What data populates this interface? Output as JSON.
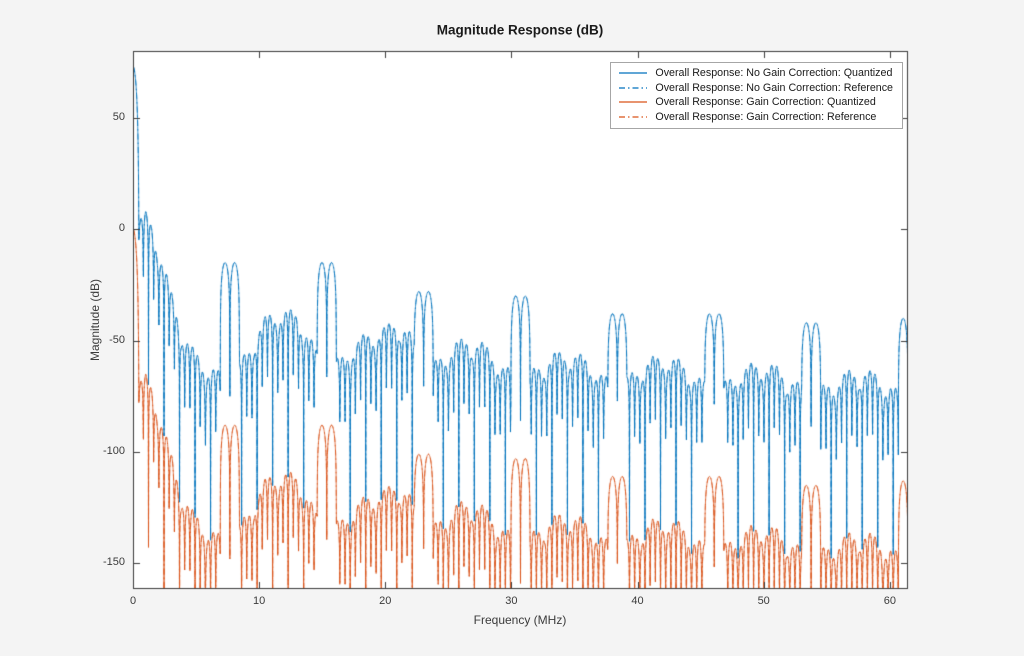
{
  "window": {
    "background": "#f4f4f4",
    "axes_background": "#ffffff"
  },
  "colors": {
    "axis_line": "#3b3b3b",
    "tick_label": "#3b3b3b",
    "title_text": "#1a1a1a",
    "legend_border": "#a6a6a6",
    "matlab_blue": "#0072BD",
    "matlab_orange": "#D95319"
  },
  "chart_data": {
    "type": "line",
    "title": "Magnitude Response (dB)",
    "xlabel": "Frequency (MHz)",
    "ylabel": "Magnitude (dB)",
    "xlim": [
      0,
      61.44
    ],
    "ylim": [
      -161.5,
      80
    ],
    "x_ticks": [
      0,
      10,
      20,
      30,
      40,
      50,
      60
    ],
    "y_ticks": [
      -150,
      -100,
      -50,
      0,
      50
    ],
    "grid": false,
    "legend_position": "northeast",
    "series": [
      {
        "name": "Overall Response: No Gain Correction: Quantized",
        "color": "#0072BD",
        "style": "solid",
        "gain_offset_db": 0
      },
      {
        "name": "Overall Response: No Gain Correction: Reference",
        "color": "#0072BD",
        "style": "dash-dot",
        "gain_offset_db": 0
      },
      {
        "name": "Overall Response: Gain Correction: Quantized",
        "color": "#D95319",
        "style": "solid",
        "gain_offset_db": -73
      },
      {
        "name": "Overall Response: Gain Correction: Reference",
        "color": "#D95319",
        "style": "dash-dot",
        "gain_offset_db": -73
      }
    ],
    "response_model": {
      "description": "Multirate decimation-filter overall magnitude response: narrow passband spike at DC (73 dB uncorrected, 0 dB gain-corrected), dense comb of stopband teeth, scalloped lobe clusters, and paired passband-image spikes at multiples of 7.68 MHz. Gain-corrected traces are identical shifted down by 73 dB; Reference traces overlay Quantized traces.",
      "passband_peak_db": 73,
      "passband_edge_mhz": 0.475,
      "image_period_mhz": 7.68,
      "image_spike_halfwidth_mhz": 0.76,
      "image_spike_levels_db": [
        -15,
        -15,
        -28,
        -30,
        -38,
        -38,
        -42,
        -40
      ],
      "tooth_period_mhz": 0.41,
      "tooth_depth_db": 75,
      "scallop_period_mhz": 1.92,
      "scallop_depth_db": 10,
      "gain_correction_db": -73,
      "sample_step_mhz": 0.015,
      "envelope_points": [
        [
          0.55,
          6
        ],
        [
          1.0,
          8
        ],
        [
          1.6,
          3
        ],
        [
          2.2,
          -10
        ],
        [
          3.0,
          -27
        ],
        [
          3.8,
          -42
        ],
        [
          4.6,
          -52
        ],
        [
          5.5,
          -58
        ],
        [
          6.5,
          -62
        ],
        [
          7.2,
          -66
        ],
        [
          8.2,
          -62
        ],
        [
          9.0,
          -54
        ],
        [
          9.8,
          -45
        ],
        [
          10.6,
          -38
        ],
        [
          11.8,
          -35
        ],
        [
          13.0,
          -37
        ],
        [
          13.8,
          -44
        ],
        [
          14.6,
          -55
        ],
        [
          16.4,
          -58
        ],
        [
          17.2,
          -52
        ],
        [
          18.0,
          -48
        ],
        [
          19.0,
          -45
        ],
        [
          20.0,
          -43
        ],
        [
          21.0,
          -40
        ],
        [
          21.8,
          -44
        ],
        [
          22.4,
          -52
        ],
        [
          23.8,
          -60
        ],
        [
          24.6,
          -55
        ],
        [
          25.6,
          -50
        ],
        [
          26.6,
          -48
        ],
        [
          27.6,
          -50
        ],
        [
          28.6,
          -55
        ],
        [
          29.6,
          -62
        ],
        [
          31.5,
          -64
        ],
        [
          32.5,
          -58
        ],
        [
          33.5,
          -55
        ],
        [
          34.5,
          -54
        ],
        [
          35.5,
          -56
        ],
        [
          36.5,
          -60
        ],
        [
          37.4,
          -66
        ],
        [
          39.2,
          -66
        ],
        [
          40.2,
          -60
        ],
        [
          41.2,
          -57
        ],
        [
          42.2,
          -56
        ],
        [
          43.2,
          -58
        ],
        [
          44.2,
          -62
        ],
        [
          45.2,
          -68
        ],
        [
          47.0,
          -68
        ],
        [
          48.0,
          -63
        ],
        [
          49.0,
          -60
        ],
        [
          50.0,
          -59
        ],
        [
          51.0,
          -61
        ],
        [
          52.0,
          -65
        ],
        [
          53.0,
          -70
        ],
        [
          54.8,
          -70
        ],
        [
          55.8,
          -66
        ],
        [
          56.8,
          -63
        ],
        [
          57.8,
          -62
        ],
        [
          58.8,
          -64
        ],
        [
          59.8,
          -68
        ],
        [
          60.8,
          -73
        ],
        [
          61.44,
          -75
        ]
      ]
    }
  }
}
